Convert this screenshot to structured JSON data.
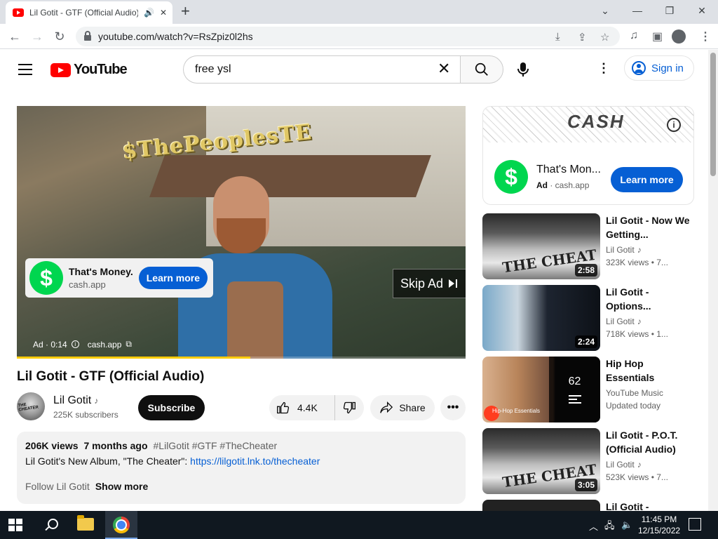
{
  "browser": {
    "tab_title": "Lil Gotit - GTF (Official Audio)",
    "tab_audio": "🔊",
    "tab_close": "✕",
    "new_tab": "+",
    "url": "youtube.com/watch?v=RsZpiz0l2hs",
    "win_dropdown": "⌄",
    "win_minimize": "—",
    "win_restore": "❐",
    "win_close": "✕"
  },
  "header": {
    "logo_text": "YouTube",
    "search_value": "free ysl",
    "signin_label": "Sign in"
  },
  "player": {
    "banner_text": "$ThePeoplesTE",
    "ad_title": "That's Money.",
    "ad_domain": "cash.app",
    "ad_cta": "Learn more",
    "skip_label": "Skip Ad",
    "ad_label": "Ad · 0:14",
    "ad_meta_domain": "cash.app",
    "progress_fraction": 0.52
  },
  "video": {
    "title": "Lil Gotit - GTF (Official Audio)",
    "channel": "Lil Gotit",
    "subscribers": "225K subscribers",
    "subscribe_label": "Subscribe",
    "likes": "4.4K",
    "share_label": "Share",
    "more": "•••"
  },
  "description": {
    "views": "206K views",
    "age": "7 months ago",
    "tags": "#LilGotit #GTF #TheCheater",
    "line2_prefix": "Lil Gotit's New Album, \"The Cheater\": ",
    "link": "https://lilgotit.lnk.to/thecheater",
    "follow_text": "Follow Lil Gotit",
    "show_more": "Show more"
  },
  "sidebar_ad": {
    "title": "That's Mon...",
    "ad_badge": "Ad",
    "domain": "· cash.app",
    "cta": "Learn more",
    "info": "i",
    "banner_text": "CASH"
  },
  "recommendations": [
    {
      "title": "Lil Gotit - Now We Getting...",
      "channel": "Lil Gotit",
      "meta": "323K views • 7...",
      "duration": "2:58"
    },
    {
      "title": "Lil Gotit - Options...",
      "channel": "Lil Gotit",
      "meta": "718K views • 1...",
      "duration": "2:24"
    },
    {
      "title": "Hip Hop Essentials",
      "channel": "YouTube Music",
      "meta": "Updated today",
      "count": "62",
      "thumb_label": "Hip-Hop Essentials"
    },
    {
      "title": "Lil Gotit - P.O.T. (Official Audio)",
      "channel": "Lil Gotit",
      "meta": "523K views • 7...",
      "duration": "3:05"
    },
    {
      "title": "Lil Gotit -"
    }
  ],
  "taskbar": {
    "time": "11:45 PM",
    "date": "12/15/2022"
  },
  "colors": {
    "accent_blue": "#065fd4",
    "youtube_red": "#ff0000",
    "cash_green": "#00d64f",
    "progress_yellow": "#ffcc00"
  }
}
